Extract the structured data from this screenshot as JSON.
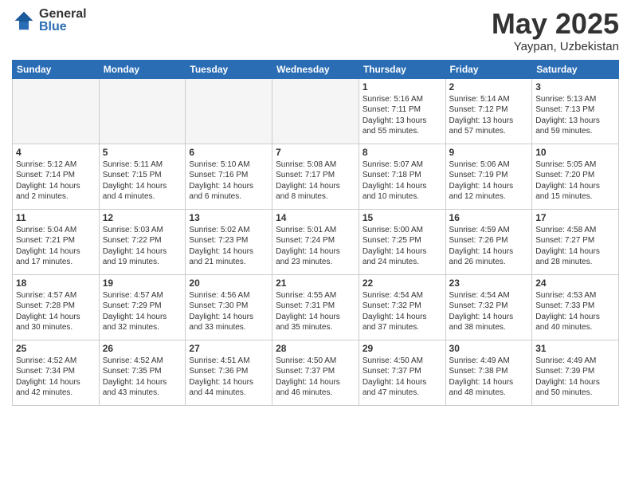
{
  "header": {
    "logo_general": "General",
    "logo_blue": "Blue",
    "month_title": "May 2025",
    "location": "Yaypan, Uzbekistan"
  },
  "weekdays": [
    "Sunday",
    "Monday",
    "Tuesday",
    "Wednesday",
    "Thursday",
    "Friday",
    "Saturday"
  ],
  "weeks": [
    [
      {
        "day": "",
        "empty": true
      },
      {
        "day": "",
        "empty": true
      },
      {
        "day": "",
        "empty": true
      },
      {
        "day": "",
        "empty": true
      },
      {
        "day": "1",
        "sunrise": "5:16 AM",
        "sunset": "7:11 PM",
        "daylight": "13 hours and 55 minutes."
      },
      {
        "day": "2",
        "sunrise": "5:14 AM",
        "sunset": "7:12 PM",
        "daylight": "13 hours and 57 minutes."
      },
      {
        "day": "3",
        "sunrise": "5:13 AM",
        "sunset": "7:13 PM",
        "daylight": "13 hours and 59 minutes."
      }
    ],
    [
      {
        "day": "4",
        "sunrise": "5:12 AM",
        "sunset": "7:14 PM",
        "daylight": "14 hours and 2 minutes."
      },
      {
        "day": "5",
        "sunrise": "5:11 AM",
        "sunset": "7:15 PM",
        "daylight": "14 hours and 4 minutes."
      },
      {
        "day": "6",
        "sunrise": "5:10 AM",
        "sunset": "7:16 PM",
        "daylight": "14 hours and 6 minutes."
      },
      {
        "day": "7",
        "sunrise": "5:08 AM",
        "sunset": "7:17 PM",
        "daylight": "14 hours and 8 minutes."
      },
      {
        "day": "8",
        "sunrise": "5:07 AM",
        "sunset": "7:18 PM",
        "daylight": "14 hours and 10 minutes."
      },
      {
        "day": "9",
        "sunrise": "5:06 AM",
        "sunset": "7:19 PM",
        "daylight": "14 hours and 12 minutes."
      },
      {
        "day": "10",
        "sunrise": "5:05 AM",
        "sunset": "7:20 PM",
        "daylight": "14 hours and 15 minutes."
      }
    ],
    [
      {
        "day": "11",
        "sunrise": "5:04 AM",
        "sunset": "7:21 PM",
        "daylight": "14 hours and 17 minutes."
      },
      {
        "day": "12",
        "sunrise": "5:03 AM",
        "sunset": "7:22 PM",
        "daylight": "14 hours and 19 minutes."
      },
      {
        "day": "13",
        "sunrise": "5:02 AM",
        "sunset": "7:23 PM",
        "daylight": "14 hours and 21 minutes."
      },
      {
        "day": "14",
        "sunrise": "5:01 AM",
        "sunset": "7:24 PM",
        "daylight": "14 hours and 23 minutes."
      },
      {
        "day": "15",
        "sunrise": "5:00 AM",
        "sunset": "7:25 PM",
        "daylight": "14 hours and 24 minutes."
      },
      {
        "day": "16",
        "sunrise": "4:59 AM",
        "sunset": "7:26 PM",
        "daylight": "14 hours and 26 minutes."
      },
      {
        "day": "17",
        "sunrise": "4:58 AM",
        "sunset": "7:27 PM",
        "daylight": "14 hours and 28 minutes."
      }
    ],
    [
      {
        "day": "18",
        "sunrise": "4:57 AM",
        "sunset": "7:28 PM",
        "daylight": "14 hours and 30 minutes."
      },
      {
        "day": "19",
        "sunrise": "4:57 AM",
        "sunset": "7:29 PM",
        "daylight": "14 hours and 32 minutes."
      },
      {
        "day": "20",
        "sunrise": "4:56 AM",
        "sunset": "7:30 PM",
        "daylight": "14 hours and 33 minutes."
      },
      {
        "day": "21",
        "sunrise": "4:55 AM",
        "sunset": "7:31 PM",
        "daylight": "14 hours and 35 minutes."
      },
      {
        "day": "22",
        "sunrise": "4:54 AM",
        "sunset": "7:32 PM",
        "daylight": "14 hours and 37 minutes."
      },
      {
        "day": "23",
        "sunrise": "4:54 AM",
        "sunset": "7:32 PM",
        "daylight": "14 hours and 38 minutes."
      },
      {
        "day": "24",
        "sunrise": "4:53 AM",
        "sunset": "7:33 PM",
        "daylight": "14 hours and 40 minutes."
      }
    ],
    [
      {
        "day": "25",
        "sunrise": "4:52 AM",
        "sunset": "7:34 PM",
        "daylight": "14 hours and 42 minutes."
      },
      {
        "day": "26",
        "sunrise": "4:52 AM",
        "sunset": "7:35 PM",
        "daylight": "14 hours and 43 minutes."
      },
      {
        "day": "27",
        "sunrise": "4:51 AM",
        "sunset": "7:36 PM",
        "daylight": "14 hours and 44 minutes."
      },
      {
        "day": "28",
        "sunrise": "4:50 AM",
        "sunset": "7:37 PM",
        "daylight": "14 hours and 46 minutes."
      },
      {
        "day": "29",
        "sunrise": "4:50 AM",
        "sunset": "7:37 PM",
        "daylight": "14 hours and 47 minutes."
      },
      {
        "day": "30",
        "sunrise": "4:49 AM",
        "sunset": "7:38 PM",
        "daylight": "14 hours and 48 minutes."
      },
      {
        "day": "31",
        "sunrise": "4:49 AM",
        "sunset": "7:39 PM",
        "daylight": "14 hours and 50 minutes."
      }
    ]
  ],
  "labels": {
    "sunrise_prefix": "Sunrise: ",
    "sunset_prefix": "Sunset: ",
    "daylight_prefix": "Daylight: "
  }
}
